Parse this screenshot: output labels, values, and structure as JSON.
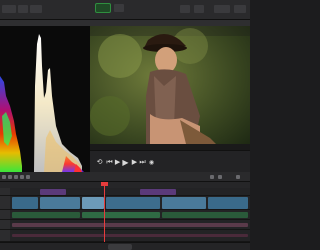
{
  "app": {
    "colors": {
      "background": "#1c1c1e",
      "panel": "#2a2a2c",
      "accent_green": "#2f8f3f",
      "playhead": "#e63c3c"
    }
  },
  "topbar": {
    "icons": [
      "layout-icon",
      "media-icon",
      "tools-icon",
      "render-icon",
      "mode-icon",
      "view-icon",
      "zoom-icon",
      "fullscreen-icon",
      "settings-icon"
    ]
  },
  "scope": {
    "title": ""
  },
  "transport": {
    "buttons": [
      {
        "name": "loop-icon",
        "glyph": "⟲"
      },
      {
        "name": "skip-back-icon",
        "glyph": "⏮"
      },
      {
        "name": "step-back-icon",
        "glyph": "◀"
      },
      {
        "name": "play-icon",
        "glyph": "▶"
      },
      {
        "name": "step-forward-icon",
        "glyph": "▶"
      },
      {
        "name": "skip-forward-icon",
        "glyph": "⏭"
      },
      {
        "name": "volume-icon",
        "glyph": "◉"
      }
    ]
  },
  "timeline": {
    "share_label": ""
  }
}
